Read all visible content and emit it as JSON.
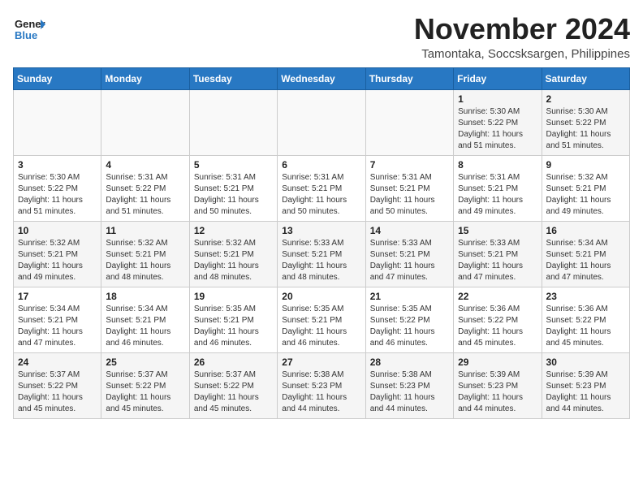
{
  "header": {
    "logo_line1": "General",
    "logo_line2": "Blue",
    "month": "November 2024",
    "location": "Tamontaka, Soccsksargen, Philippines"
  },
  "weekdays": [
    "Sunday",
    "Monday",
    "Tuesday",
    "Wednesday",
    "Thursday",
    "Friday",
    "Saturday"
  ],
  "weeks": [
    [
      {
        "day": "",
        "info": ""
      },
      {
        "day": "",
        "info": ""
      },
      {
        "day": "",
        "info": ""
      },
      {
        "day": "",
        "info": ""
      },
      {
        "day": "",
        "info": ""
      },
      {
        "day": "1",
        "info": "Sunrise: 5:30 AM\nSunset: 5:22 PM\nDaylight: 11 hours and 51 minutes."
      },
      {
        "day": "2",
        "info": "Sunrise: 5:30 AM\nSunset: 5:22 PM\nDaylight: 11 hours and 51 minutes."
      }
    ],
    [
      {
        "day": "3",
        "info": "Sunrise: 5:30 AM\nSunset: 5:22 PM\nDaylight: 11 hours and 51 minutes."
      },
      {
        "day": "4",
        "info": "Sunrise: 5:31 AM\nSunset: 5:22 PM\nDaylight: 11 hours and 51 minutes."
      },
      {
        "day": "5",
        "info": "Sunrise: 5:31 AM\nSunset: 5:21 PM\nDaylight: 11 hours and 50 minutes."
      },
      {
        "day": "6",
        "info": "Sunrise: 5:31 AM\nSunset: 5:21 PM\nDaylight: 11 hours and 50 minutes."
      },
      {
        "day": "7",
        "info": "Sunrise: 5:31 AM\nSunset: 5:21 PM\nDaylight: 11 hours and 50 minutes."
      },
      {
        "day": "8",
        "info": "Sunrise: 5:31 AM\nSunset: 5:21 PM\nDaylight: 11 hours and 49 minutes."
      },
      {
        "day": "9",
        "info": "Sunrise: 5:32 AM\nSunset: 5:21 PM\nDaylight: 11 hours and 49 minutes."
      }
    ],
    [
      {
        "day": "10",
        "info": "Sunrise: 5:32 AM\nSunset: 5:21 PM\nDaylight: 11 hours and 49 minutes."
      },
      {
        "day": "11",
        "info": "Sunrise: 5:32 AM\nSunset: 5:21 PM\nDaylight: 11 hours and 48 minutes."
      },
      {
        "day": "12",
        "info": "Sunrise: 5:32 AM\nSunset: 5:21 PM\nDaylight: 11 hours and 48 minutes."
      },
      {
        "day": "13",
        "info": "Sunrise: 5:33 AM\nSunset: 5:21 PM\nDaylight: 11 hours and 48 minutes."
      },
      {
        "day": "14",
        "info": "Sunrise: 5:33 AM\nSunset: 5:21 PM\nDaylight: 11 hours and 47 minutes."
      },
      {
        "day": "15",
        "info": "Sunrise: 5:33 AM\nSunset: 5:21 PM\nDaylight: 11 hours and 47 minutes."
      },
      {
        "day": "16",
        "info": "Sunrise: 5:34 AM\nSunset: 5:21 PM\nDaylight: 11 hours and 47 minutes."
      }
    ],
    [
      {
        "day": "17",
        "info": "Sunrise: 5:34 AM\nSunset: 5:21 PM\nDaylight: 11 hours and 47 minutes."
      },
      {
        "day": "18",
        "info": "Sunrise: 5:34 AM\nSunset: 5:21 PM\nDaylight: 11 hours and 46 minutes."
      },
      {
        "day": "19",
        "info": "Sunrise: 5:35 AM\nSunset: 5:21 PM\nDaylight: 11 hours and 46 minutes."
      },
      {
        "day": "20",
        "info": "Sunrise: 5:35 AM\nSunset: 5:21 PM\nDaylight: 11 hours and 46 minutes."
      },
      {
        "day": "21",
        "info": "Sunrise: 5:35 AM\nSunset: 5:22 PM\nDaylight: 11 hours and 46 minutes."
      },
      {
        "day": "22",
        "info": "Sunrise: 5:36 AM\nSunset: 5:22 PM\nDaylight: 11 hours and 45 minutes."
      },
      {
        "day": "23",
        "info": "Sunrise: 5:36 AM\nSunset: 5:22 PM\nDaylight: 11 hours and 45 minutes."
      }
    ],
    [
      {
        "day": "24",
        "info": "Sunrise: 5:37 AM\nSunset: 5:22 PM\nDaylight: 11 hours and 45 minutes."
      },
      {
        "day": "25",
        "info": "Sunrise: 5:37 AM\nSunset: 5:22 PM\nDaylight: 11 hours and 45 minutes."
      },
      {
        "day": "26",
        "info": "Sunrise: 5:37 AM\nSunset: 5:22 PM\nDaylight: 11 hours and 45 minutes."
      },
      {
        "day": "27",
        "info": "Sunrise: 5:38 AM\nSunset: 5:23 PM\nDaylight: 11 hours and 44 minutes."
      },
      {
        "day": "28",
        "info": "Sunrise: 5:38 AM\nSunset: 5:23 PM\nDaylight: 11 hours and 44 minutes."
      },
      {
        "day": "29",
        "info": "Sunrise: 5:39 AM\nSunset: 5:23 PM\nDaylight: 11 hours and 44 minutes."
      },
      {
        "day": "30",
        "info": "Sunrise: 5:39 AM\nSunset: 5:23 PM\nDaylight: 11 hours and 44 minutes."
      }
    ]
  ]
}
